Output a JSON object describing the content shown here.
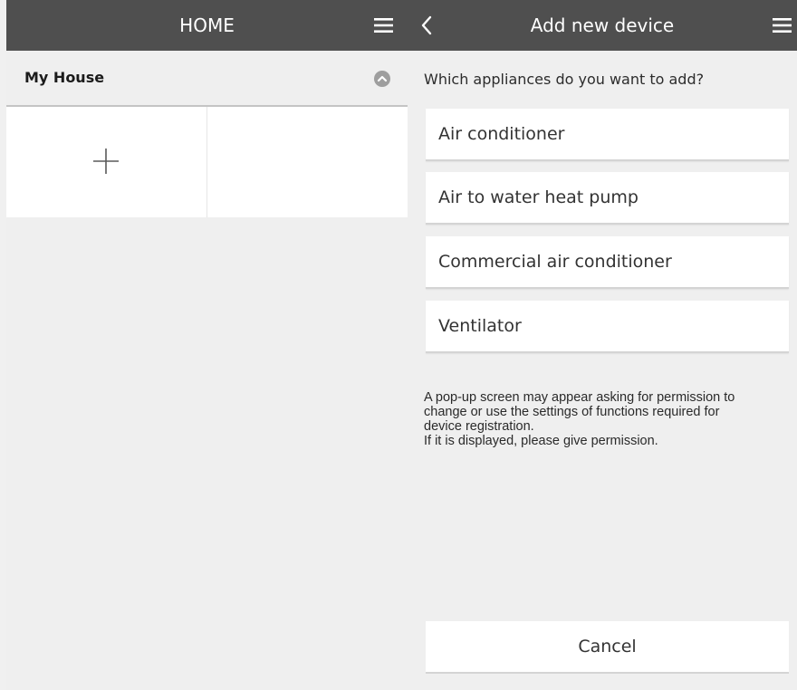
{
  "colors": {
    "header_bg": "#4f4f4f",
    "header_text": "#ffffff",
    "page_bg": "#efefef",
    "card_bg": "#ffffff"
  },
  "home": {
    "title": "HOME",
    "menu_icon": "hamburger-menu-icon",
    "section_label": "My House",
    "collapse_icon": "chevron-up-circle-icon",
    "add_icon": "plus-icon"
  },
  "add_device": {
    "back_icon": "chevron-left-icon",
    "title": "Add new device",
    "menu_icon": "hamburger-menu-icon",
    "question": "Which appliances do you want to add?",
    "options": [
      {
        "label": "Air conditioner"
      },
      {
        "label": "Air to water heat pump"
      },
      {
        "label": "Commercial air conditioner"
      },
      {
        "label": "Ventilator"
      }
    ],
    "note_lines": [
      "A pop-up screen may appear asking for permission to",
      "change or use the settings of functions required for",
      "device registration.",
      "If it is displayed, please give permission."
    ],
    "cancel_label": "Cancel"
  }
}
